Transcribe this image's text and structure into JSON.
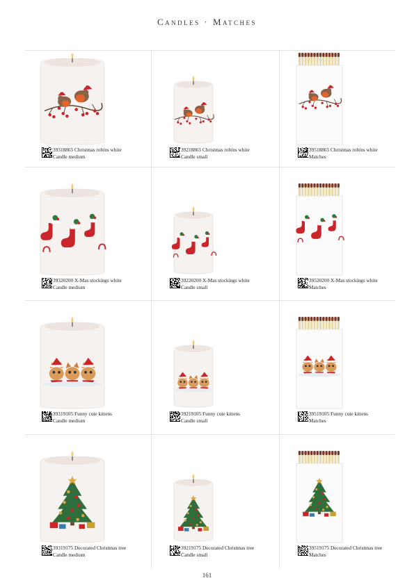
{
  "header": {
    "title": "Candles · Matches"
  },
  "page_number": "161",
  "rows": [
    {
      "design": "robins",
      "cells": [
        {
          "type": "candle-medium",
          "code": "39318865",
          "name": "Christmas robins white",
          "format": "Candle medium"
        },
        {
          "type": "candle-small",
          "code": "39218865",
          "name": "Christmas robins white",
          "format": "Candle small"
        },
        {
          "type": "matches",
          "code": "39518865",
          "name": "Christmas robins white",
          "format": "Matches"
        }
      ]
    },
    {
      "design": "stockings",
      "cells": [
        {
          "type": "candle-medium",
          "code": "39320200",
          "name": "X-Mas stockings white",
          "format": "Candle medium"
        },
        {
          "type": "candle-small",
          "code": "39220200",
          "name": "X-Mas stockings white",
          "format": "Candle small"
        },
        {
          "type": "matches",
          "code": "39520200",
          "name": "X-Mas stockings white",
          "format": "Matches"
        }
      ]
    },
    {
      "design": "kittens",
      "cells": [
        {
          "type": "candle-medium",
          "code": "39319105",
          "name": "Funny cute kittens",
          "format": "Candle medium"
        },
        {
          "type": "candle-small",
          "code": "39219105",
          "name": "Funny cute kittens",
          "format": "Candle small"
        },
        {
          "type": "matches",
          "code": "39519105",
          "name": "Funny cute kittens",
          "format": "Matches"
        }
      ]
    },
    {
      "design": "tree",
      "cells": [
        {
          "type": "candle-medium",
          "code": "39319175",
          "name": "Decorated Christmas tree",
          "format": "Candle medium"
        },
        {
          "type": "candle-small",
          "code": "39219175",
          "name": "Decorated Christmas tree",
          "format": "Candle small"
        },
        {
          "type": "matches",
          "code": "39519175",
          "name": "Decorated Christmas tree",
          "format": "Matches"
        }
      ]
    }
  ],
  "colors": {
    "red": "#c8262b",
    "green": "#2f7a3a",
    "match_head": "#7a3a2a",
    "match_stick": "#e9d7a6",
    "candle": "#f6f2ef",
    "grid": "#e2e2e2"
  }
}
